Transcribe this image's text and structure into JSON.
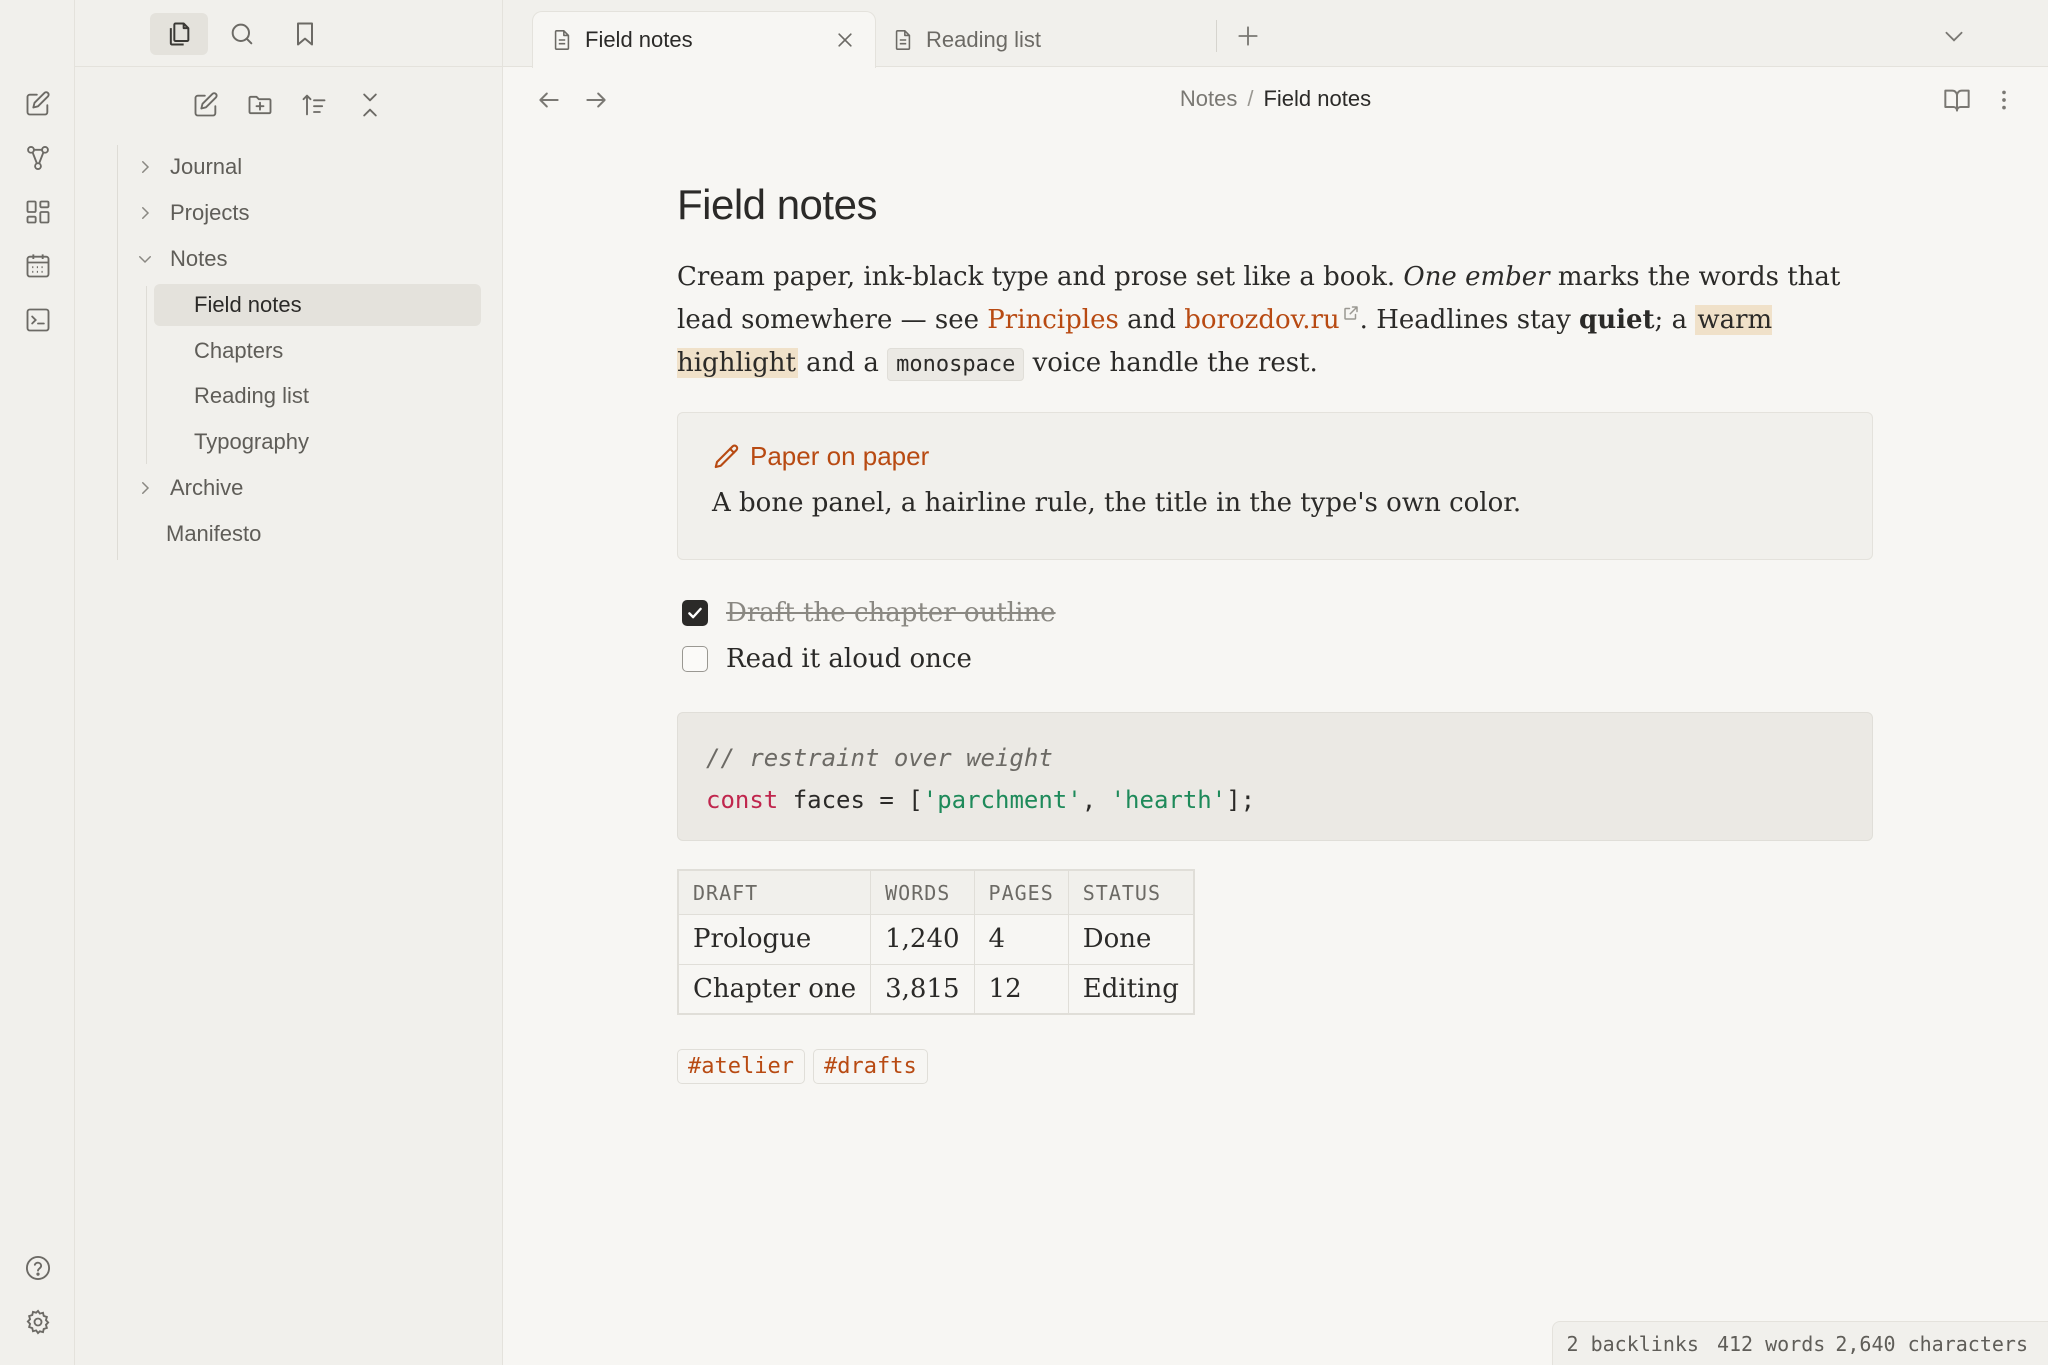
{
  "ribbon": {
    "top": [
      "new-note-icon",
      "graph-view-icon",
      "canvas-icon",
      "calendar-icon",
      "terminal-icon"
    ],
    "bottom": [
      "help-icon",
      "settings-icon"
    ]
  },
  "sidebar": {
    "tabs": [
      "files-icon",
      "search-icon",
      "bookmark-icon"
    ],
    "actions": [
      "new-note-icon",
      "new-folder-icon",
      "sort-icon",
      "collapse-all-icon"
    ],
    "tree": {
      "journal": "Journal",
      "projects": "Projects",
      "notes": "Notes",
      "field_notes": "Field notes",
      "chapters": "Chapters",
      "reading_list": "Reading list",
      "typography": "Typography",
      "archive": "Archive",
      "manifesto": "Manifesto"
    }
  },
  "tabs": {
    "active": "Field notes",
    "second": "Reading list"
  },
  "breadcrumb": {
    "folder": "Notes",
    "separator": "/",
    "current": "Field notes"
  },
  "note": {
    "title": "Field notes",
    "para": {
      "t1": "Cream paper, ink-black type and prose set like a book. ",
      "em": "One ember",
      "t2": " marks the words that lead somewhere — see ",
      "link1": "Principles",
      "t3": " and ",
      "link2": "borozdov.ru",
      "t4": ". Headlines stay ",
      "bold": "quiet",
      "t5": "; a ",
      "highlight": "warm highlight",
      "t6": " and a ",
      "code": "monospace",
      "t7": " voice handle the rest."
    },
    "callout": {
      "title": "Paper on paper",
      "body": "A bone panel, a hairline rule, the title in the type's own color."
    },
    "tasks": [
      {
        "label": "Draft the chapter outline",
        "done": true
      },
      {
        "label": "Read it aloud once",
        "done": false
      }
    ],
    "code": {
      "comment": "// restraint over weight",
      "keyword": "const",
      "ident": " faces = [",
      "str1": "'parchment'",
      "comma": ", ",
      "str2": "'hearth'",
      "end": "];"
    },
    "table": {
      "headers": [
        "DRAFT",
        "WORDS",
        "PAGES",
        "STATUS"
      ],
      "rows": [
        [
          "Prologue",
          "1,240",
          "4",
          "Done"
        ],
        [
          "Chapter one",
          "3,815",
          "12",
          "Editing"
        ]
      ]
    },
    "tags": [
      "#atelier",
      "#drafts"
    ]
  },
  "status": {
    "backlinks": "2 backlinks",
    "words": "412 words",
    "chars": "2,640 characters"
  },
  "colors": {
    "accent": "#b84a12",
    "highlight": "#f0e1c9",
    "keyword": "#c0264d",
    "string": "#1e8a5a"
  }
}
